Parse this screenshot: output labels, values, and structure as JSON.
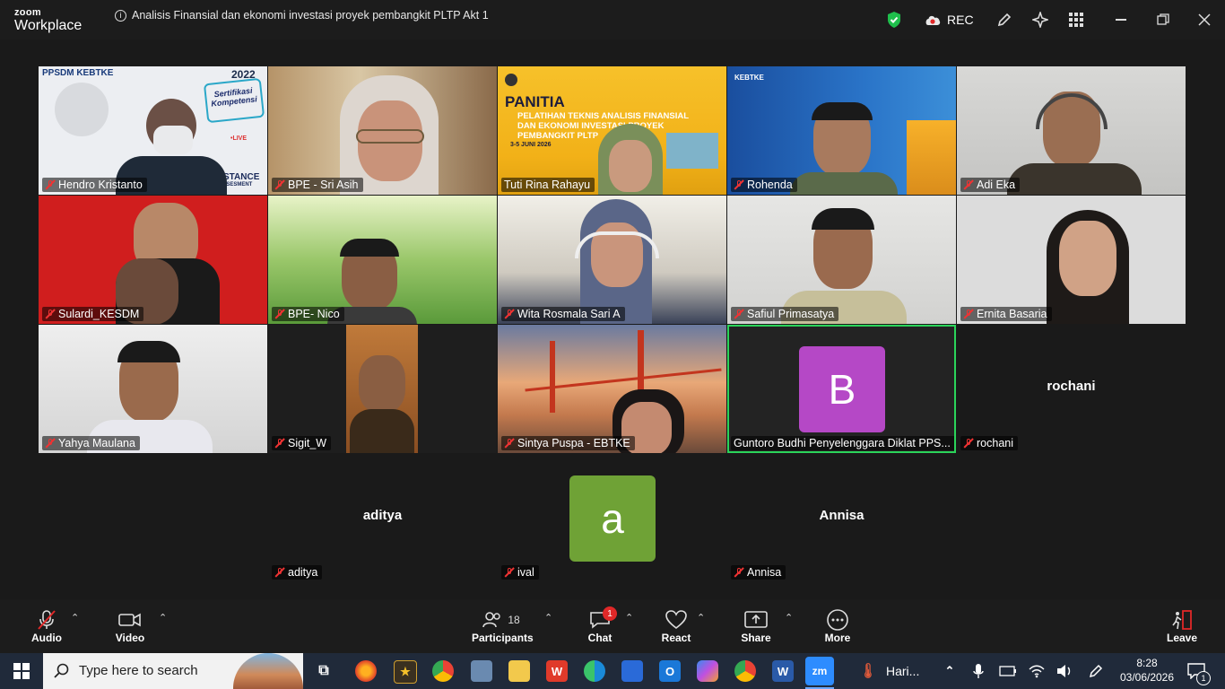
{
  "app": {
    "logo_top": "zoom",
    "logo_bottom": "Workplace",
    "meeting_title": "Analisis Finansial dan ekonomi investasi proyek pembangkit PLTP Akt 1",
    "rec_label": "REC"
  },
  "tile_slides": {
    "t0_org": "PPSDM KEBTKE",
    "t0_year": "2022",
    "t0_cert": "Sertifikasi Kompetensi",
    "t0_live": "•LIVE",
    "t0_distance": "DISTANCE",
    "t0_assess": "ASSESMENT",
    "t2_panitia": "PANITIA",
    "t2_line1": "PELATIHAN TEKNIS ANALISIS FINANSIAL",
    "t2_line2": "DAN EKONOMI INVESTASI PROYEK",
    "t2_line3": "PEMBANGKIT PLTP",
    "t2_date": "3-5 JUNI 2026",
    "t3_org": "KEBTKE"
  },
  "participants": [
    {
      "name": "Hendro Kristanto"
    },
    {
      "name": "BPE - Sri Asih"
    },
    {
      "name": "Tuti Rina Rahayu"
    },
    {
      "name": "Rohenda"
    },
    {
      "name": "Adi Eka"
    },
    {
      "name": "Sulardi_KESDM"
    },
    {
      "name": "BPE- Nico"
    },
    {
      "name": "Wita Rosmala Sari A"
    },
    {
      "name": "Safiul Primasatya"
    },
    {
      "name": "Ernita Basaria"
    },
    {
      "name": "Yahya Maulana"
    },
    {
      "name": "Sigit_W"
    },
    {
      "name": "Sintya Puspa - EBTKE"
    },
    {
      "name": "Guntoro Budhi Penyelenggara Diklat PPS...",
      "avatar_letter": "B",
      "avatar_color": "#b548c6"
    },
    {
      "name": "rochani",
      "center_name": "rochani"
    },
    {
      "name": "aditya",
      "center_name": "aditya"
    },
    {
      "name": "ival",
      "avatar_letter": "a",
      "avatar_color": "#6fa236"
    },
    {
      "name": "Annisa",
      "center_name": "Annisa"
    }
  ],
  "controls": {
    "audio": "Audio",
    "video": "Video",
    "participants": "Participants",
    "participants_count": "18",
    "chat": "Chat",
    "chat_badge": "1",
    "react": "React",
    "share": "Share",
    "more": "More",
    "leave": "Leave"
  },
  "taskbar": {
    "search_placeholder": "Type here to search",
    "weather": "Hari...",
    "time": "8:28",
    "date": "03/06/2026",
    "notif_count": "1"
  },
  "colors": {
    "active_speaker_border": "#2bd45a",
    "leave_red": "#e02828",
    "shield_green": "#1fbf4c"
  }
}
